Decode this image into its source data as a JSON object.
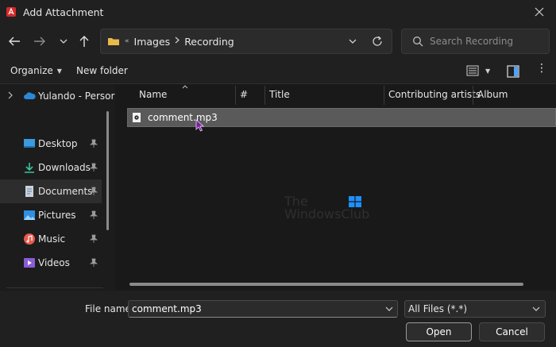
{
  "window": {
    "title": "Add Attachment"
  },
  "navigation": {
    "address": {
      "overflow": "«",
      "crumbs": [
        "Images",
        "Recording"
      ]
    },
    "search": {
      "placeholder": "Search Recording"
    }
  },
  "toolbar": {
    "organize_label": "Organize",
    "new_folder_label": "New folder"
  },
  "sidebar": {
    "onedrive_label": "Yulando - Persor",
    "items": [
      {
        "label": "Desktop",
        "icon": "desktop-icon"
      },
      {
        "label": "Downloads",
        "icon": "download-icon"
      },
      {
        "label": "Documents",
        "icon": "documents-icon",
        "selected": true
      },
      {
        "label": "Pictures",
        "icon": "pictures-icon"
      },
      {
        "label": "Music",
        "icon": "music-icon"
      },
      {
        "label": "Videos",
        "icon": "videos-icon"
      }
    ]
  },
  "file_list": {
    "columns": [
      "Name",
      "#",
      "Title",
      "Contributing artists",
      "Album"
    ],
    "files": [
      {
        "name": "comment.mp3",
        "selected": true
      }
    ]
  },
  "watermark": {
    "line1": "The",
    "line2": "WindowsClub"
  },
  "footer": {
    "file_name_label": "File name:",
    "file_name_value": "comment.mp3",
    "file_type_value": "All Files (*.*)",
    "open_label": "Open",
    "cancel_label": "Cancel"
  },
  "colors": {
    "background": "#1c1c1c",
    "panel": "#202020",
    "selection": "#5a5a5a",
    "accent_blue": "#1e90ff"
  }
}
